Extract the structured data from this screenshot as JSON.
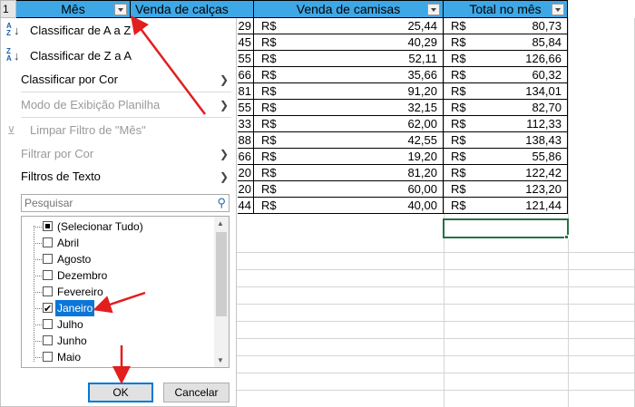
{
  "header": {
    "row_number": "1",
    "col_mes": "Mês",
    "col_calcas": "Venda de calças",
    "col_camisas": "Venda de camisas",
    "col_total": "Total no mês"
  },
  "rows": [
    {
      "calcas_partial": "29",
      "camisas_cur": "R$",
      "camisas": "25,44",
      "total_cur": "R$",
      "total": "80,73"
    },
    {
      "calcas_partial": "45",
      "camisas_cur": "R$",
      "camisas": "40,29",
      "total_cur": "R$",
      "total": "85,84"
    },
    {
      "calcas_partial": "55",
      "camisas_cur": "R$",
      "camisas": "52,11",
      "total_cur": "R$",
      "total": "126,66"
    },
    {
      "calcas_partial": "66",
      "camisas_cur": "R$",
      "camisas": "35,66",
      "total_cur": "R$",
      "total": "60,32"
    },
    {
      "calcas_partial": "81",
      "camisas_cur": "R$",
      "camisas": "91,20",
      "total_cur": "R$",
      "total": "134,01"
    },
    {
      "calcas_partial": "55",
      "camisas_cur": "R$",
      "camisas": "32,15",
      "total_cur": "R$",
      "total": "82,70"
    },
    {
      "calcas_partial": "33",
      "camisas_cur": "R$",
      "camisas": "62,00",
      "total_cur": "R$",
      "total": "112,33"
    },
    {
      "calcas_partial": "88",
      "camisas_cur": "R$",
      "camisas": "42,55",
      "total_cur": "R$",
      "total": "138,43"
    },
    {
      "calcas_partial": "66",
      "camisas_cur": "R$",
      "camisas": "19,20",
      "total_cur": "R$",
      "total": "55,86"
    },
    {
      "calcas_partial": "20",
      "camisas_cur": "R$",
      "camisas": "81,20",
      "total_cur": "R$",
      "total": "122,42"
    },
    {
      "calcas_partial": "20",
      "camisas_cur": "R$",
      "camisas": "60,00",
      "total_cur": "R$",
      "total": "123,20"
    },
    {
      "calcas_partial": "44",
      "camisas_cur": "R$",
      "camisas": "40,00",
      "total_cur": "R$",
      "total": "121,44"
    }
  ],
  "menu": {
    "sort_az": "Classificar de A a Z",
    "sort_za": "Classificar de Z a A",
    "sort_color": "Classificar por Cor",
    "sheet_view": "Modo de Exibição Planilha",
    "clear_filter": "Limpar Filtro de \"Mês\"",
    "filter_color": "Filtrar por Cor",
    "text_filters": "Filtros de Texto",
    "search_placeholder": "Pesquisar",
    "list": [
      {
        "label": "(Selecionar Tudo)",
        "state": "partial"
      },
      {
        "label": "Abril",
        "state": "unchecked"
      },
      {
        "label": "Agosto",
        "state": "unchecked"
      },
      {
        "label": "Dezembro",
        "state": "unchecked"
      },
      {
        "label": "Fevereiro",
        "state": "unchecked"
      },
      {
        "label": "Janeiro",
        "state": "checked"
      },
      {
        "label": "Julho",
        "state": "unchecked"
      },
      {
        "label": "Junho",
        "state": "unchecked"
      },
      {
        "label": "Maio",
        "state": "unchecked"
      }
    ],
    "ok": "OK",
    "cancel": "Cancelar"
  },
  "colors": {
    "header_bg": "#3ea8e6",
    "selection": "#0b76d8",
    "arrow": "#e21e1e",
    "active_cell": "#217346"
  }
}
